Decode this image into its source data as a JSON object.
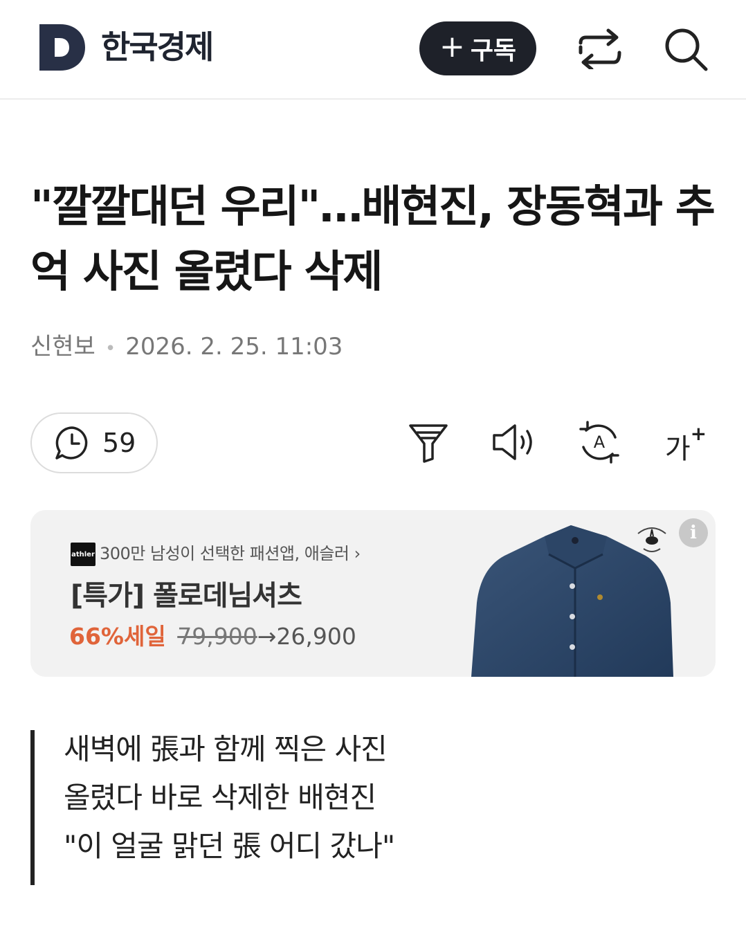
{
  "header": {
    "brand": "한국경제",
    "subscribe_label": "구독"
  },
  "article": {
    "title": "\"깔깔대던 우리\"…배현진, 장동혁과 추억 사진 올렸다 삭제",
    "author": "신현보",
    "datetime": "2026. 2. 25. 11:03",
    "comment_count": "59",
    "font_size_label": "가"
  },
  "ad": {
    "logo_text": "athler",
    "tagline": "300만 남성이 선택한 패션앱, 애슬러",
    "title": "[특가] 폴로데님셔츠",
    "sale_text": "66%세일",
    "original_price": "79,900",
    "arrow": "→",
    "sale_price": "26,900",
    "info_label": "i"
  },
  "summary": {
    "lines": [
      "새벽에 張과 함께 찍은 사진",
      "올렸다 바로 삭제한 배현진",
      "\"이 얼굴 맑던 張 어디 갔나\""
    ]
  },
  "colors": {
    "header_button_bg": "#1e2129",
    "ad_bg": "#f2f2f2",
    "sale_orange": "#e0643a",
    "summary_bar": "#222222"
  }
}
